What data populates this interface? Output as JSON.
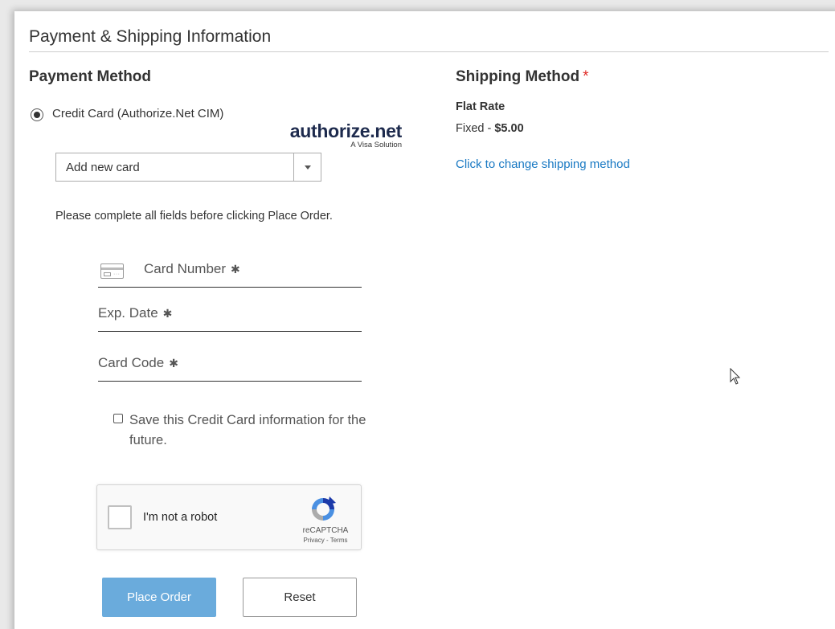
{
  "section": {
    "title": "Payment & Shipping Information"
  },
  "payment": {
    "heading": "Payment Method",
    "option_label": "Credit Card (Authorize.Net CIM)",
    "logo_word": "authorize.net",
    "logo_tagline": "A Visa Solution",
    "card_select": {
      "selected": "Add new card",
      "icon": "chevron-down-icon"
    },
    "instructions": "Please complete all fields before clicking Place Order.",
    "fields": {
      "card_number": "Card Number",
      "exp_date": "Exp. Date",
      "card_code": "Card Code",
      "required_marker": "✱",
      "card_icon": "credit-card-icon"
    },
    "save_card_label": "Save this Credit Card information for the future.",
    "recaptcha": {
      "label": "I'm not a robot",
      "brand": "reCAPTCHA",
      "links": "Privacy - Terms"
    },
    "buttons": {
      "place_order": "Place Order",
      "reset": "Reset"
    }
  },
  "shipping": {
    "heading": "Shipping Method",
    "required_marker": "*",
    "method_name": "Flat Rate",
    "price_prefix": "Fixed - ",
    "price": "$5.00",
    "change_link": "Click to change shipping method"
  },
  "colors": {
    "link": "#1979c3",
    "primary_button": "#6aabdc",
    "required": "#e02b27",
    "logo": "#1d2a4d"
  }
}
